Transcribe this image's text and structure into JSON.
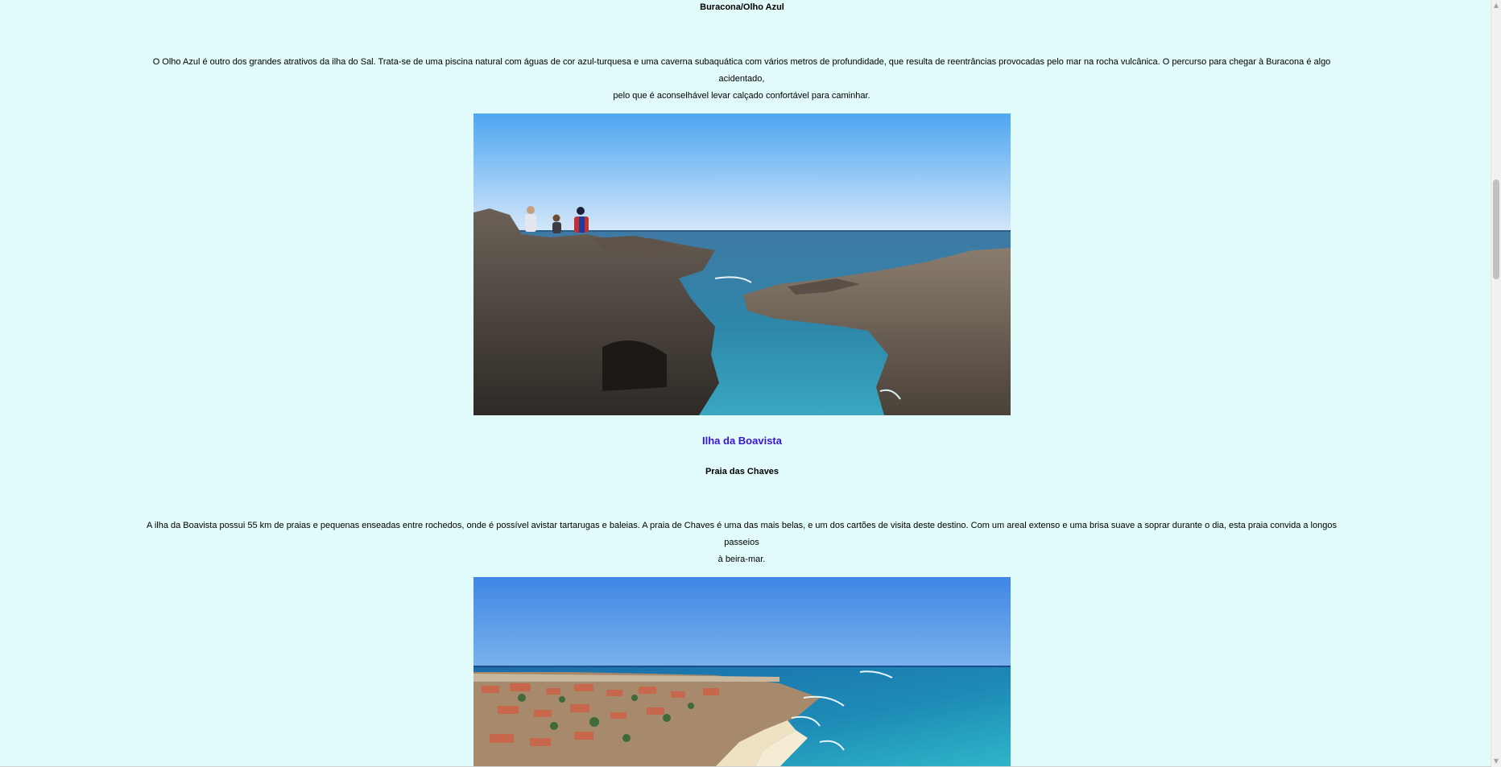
{
  "sections": [
    {
      "subheading": "Buracona/Olho Azul",
      "paragraph_line1": "O Olho Azul é outro dos grandes atrativos da ilha do Sal. Trata-se de uma piscina natural com águas de cor azul-turquesa e uma caverna subaquática com vários metros de profundidade, que resulta de reentrâncias provocadas pelo mar na rocha vulcânica. O percurso para chegar à Buracona é algo acidentado,",
      "paragraph_line2": "pelo que é aconselhável levar calçado confortável para caminhar."
    },
    {
      "island_title": "Ilha da Boavista",
      "subheading": "Praia das Chaves",
      "paragraph_line1": "A ilha da Boavista possui 55 km de praias e pequenas enseadas entre rochedos, onde é possível avistar tartarugas e baleias. A praia de Chaves é uma das mais belas, e um dos cartões de visita deste destino. Com um areal extenso e uma brisa suave a soprar durante o dia, esta praia convida a longos passeios",
      "paragraph_line2": "à beira-mar."
    }
  ],
  "scrollbar": {
    "up_arrow": "▲",
    "down_arrow": "▼",
    "scroll_position": 0.22
  },
  "colors": {
    "background": "#e0fbfa",
    "island_title": "#3a14d6"
  }
}
